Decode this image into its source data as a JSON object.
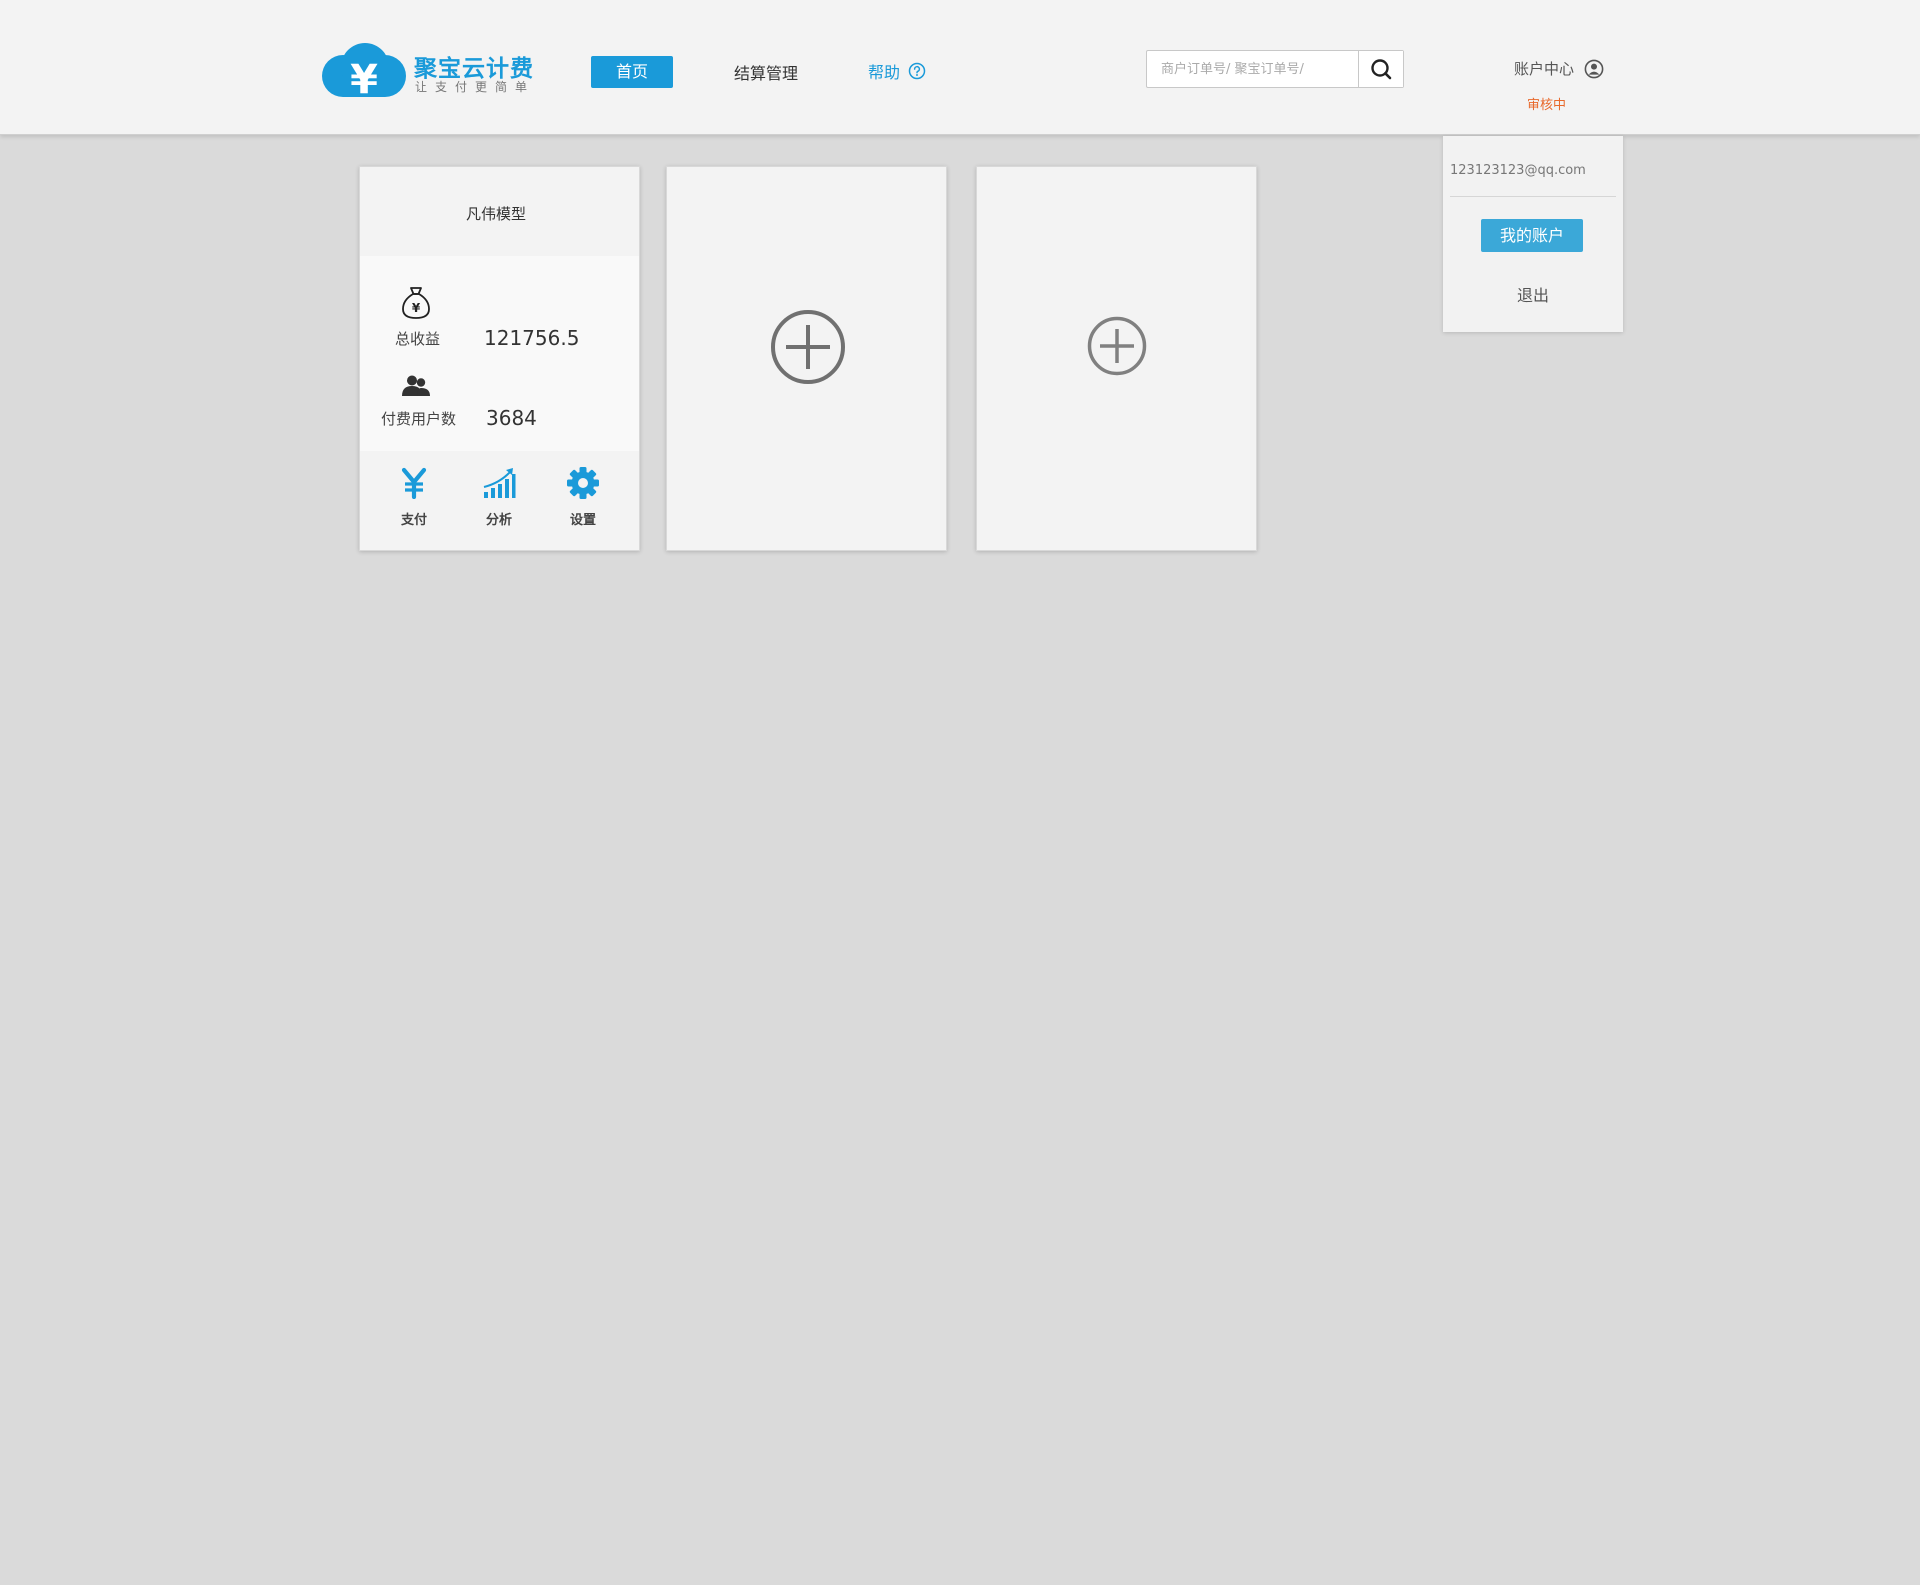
{
  "brand": {
    "name": "聚宝云计费",
    "slogan": "让支付更简单",
    "logo_symbol": "¥",
    "color": "#1a9ad9"
  },
  "nav": {
    "home": "首页",
    "settlement": "结算管理",
    "help": "帮助"
  },
  "search": {
    "placeholder": "商户订单号/ 聚宝订单号/"
  },
  "account": {
    "center_label": "账户中心",
    "status": "审核中",
    "status_color": "#e8692c"
  },
  "dropdown": {
    "email": "123123123@qq.com",
    "my_account": "我的账户",
    "logout": "退出"
  },
  "app_card": {
    "title": "凡伟模型",
    "income_label": "总收益",
    "income_value": "121756.5",
    "users_label": "付费用户数",
    "users_value": "3684",
    "actions": {
      "pay": "支付",
      "analysis": "分析",
      "settings": "设置"
    }
  },
  "icons": {
    "logo": "cloud-yen-icon",
    "help": "question-circle-icon",
    "search": "search-icon",
    "account": "user-circle-icon",
    "income": "money-bag-icon",
    "users": "users-icon",
    "pay": "yen-icon",
    "analysis": "bar-chart-icon",
    "settings": "gear-icon",
    "add": "plus-circle-icon"
  }
}
